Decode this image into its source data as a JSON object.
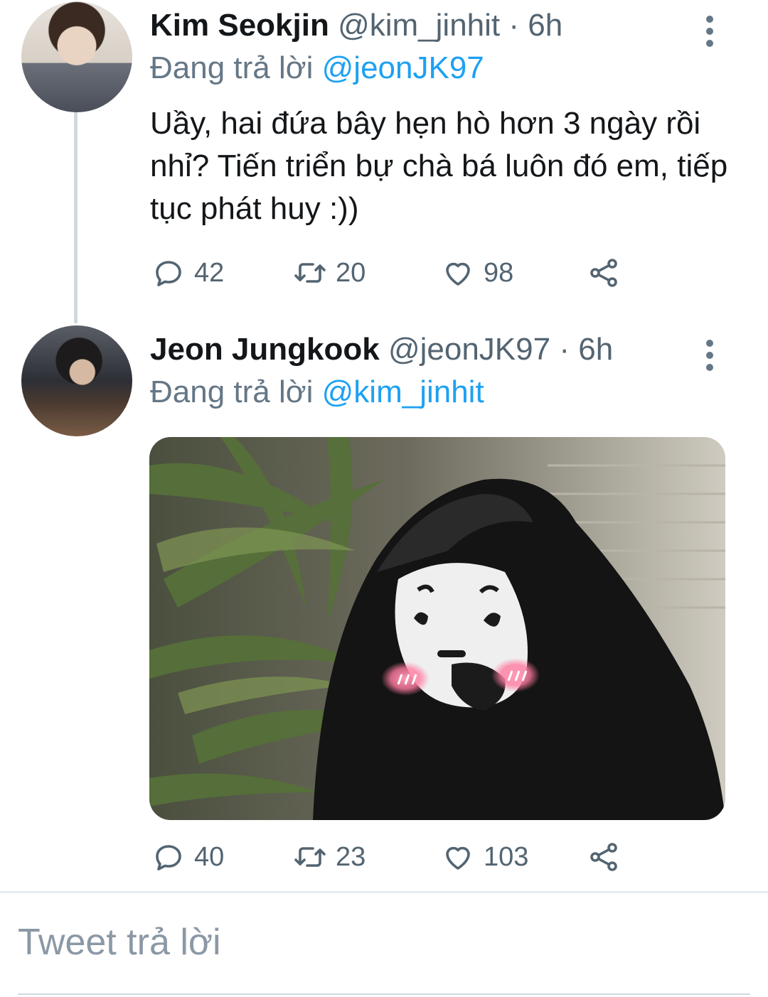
{
  "tweets": [
    {
      "name": "Kim Seokjin",
      "handle": "@kim_jinhit",
      "sep": " · ",
      "time": "6h",
      "replying_prefix": "Đang trả lời ",
      "replying_to": "@jeonJK97",
      "text": "Uầy, hai đứa bây hẹn hò hơn 3 ngày rồi nhỉ? Tiến triển bự chà bá luôn đó em, tiếp tục phát huy :))",
      "replies": "42",
      "retweets": "20",
      "likes": "98"
    },
    {
      "name": "Jeon Jungkook",
      "handle": "@jeonJK97",
      "sep": " · ",
      "time": "6h",
      "replying_prefix": "Đang trả lời ",
      "replying_to": "@kim_jinhit",
      "replies": "40",
      "retweets": "23",
      "likes": "103"
    }
  ],
  "reply_box": {
    "placeholder": "Tweet trả lời"
  },
  "icons": {
    "reply": "reply-icon",
    "retweet": "retweet-icon",
    "like": "heart-icon",
    "share": "share-icon",
    "more": "more-vertical-icon"
  },
  "colors": {
    "accent": "#1da1f2",
    "secondary": "#657786",
    "text": "#14171a"
  }
}
